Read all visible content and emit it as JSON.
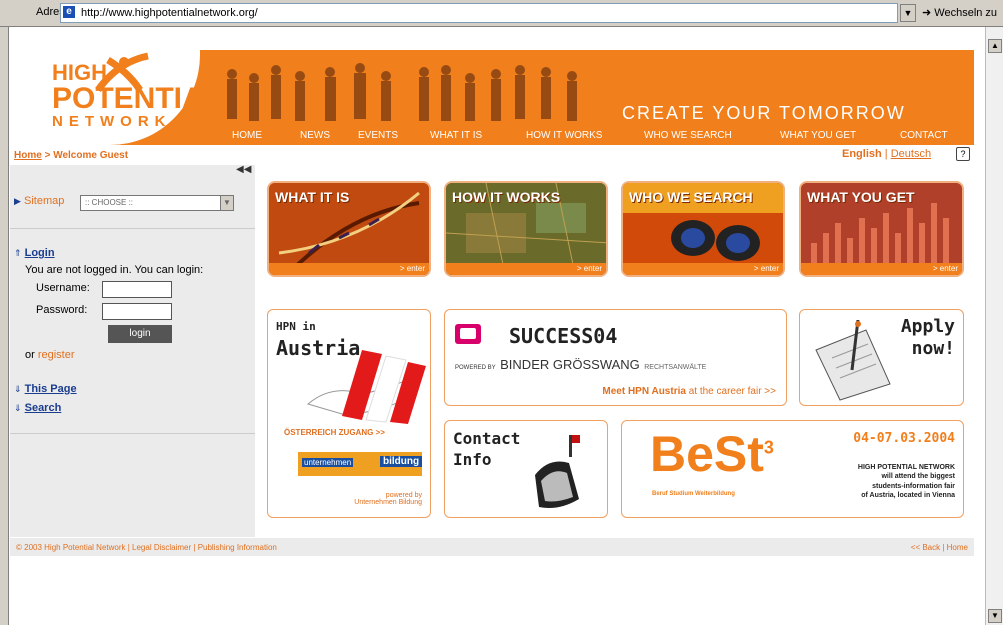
{
  "browser": {
    "address_label": "Adresse",
    "url": "http://www.highpotentialnetwork.org/",
    "go_label": "Wechseln zu"
  },
  "header": {
    "logo": {
      "line1": "HIGH",
      "line2": "POTENTIAL",
      "line3": "NETWORK"
    },
    "tagline": "CREATE YOUR TOMORROW",
    "nav": [
      "HOME",
      "NEWS",
      "EVENTS",
      "WHAT IT IS",
      "HOW IT WORKS",
      "WHO WE SEARCH",
      "WHAT YOU GET",
      "CONTACT"
    ]
  },
  "breadcrumb": {
    "home": "Home",
    "rest": " > Welcome Guest"
  },
  "language": {
    "english": "English",
    "sep": " | ",
    "deutsch": "Deutsch"
  },
  "sidebar": {
    "sitemap_label": "Sitemap",
    "sitemap_select": ":: CHOOSE ::",
    "login_title": "Login",
    "login_text": "You are not logged in. You can login:",
    "username_label": "Username:",
    "password_label": "Password:",
    "login_button": "login",
    "register_prefix": "or ",
    "register_link": "register",
    "this_page": "This Page",
    "search": "Search"
  },
  "tiles": [
    {
      "title": "WHAT IT IS",
      "enter": "> enter"
    },
    {
      "title": "HOW IT WORKS",
      "enter": "> enter"
    },
    {
      "title": "WHO WE SEARCH",
      "enter": "> enter"
    },
    {
      "title": "WHAT YOU GET",
      "enter": "> enter"
    }
  ],
  "austria": {
    "line1": "HPN in",
    "line2": "Austria",
    "zugang": "ÖSTERREICH ZUGANG >>",
    "partner_a": "unternehmen",
    "partner_b": "bildung",
    "powered1": "powered by",
    "powered2": "Unternehmen Bildung"
  },
  "success": {
    "title": "SUCCESS04",
    "powered": "POWERED BY",
    "sponsor": "BINDER GRÖSSWANG",
    "sponsor_suffix": "RECHTSANWÄLTE",
    "meet": "Meet HPN Austria",
    "fair": " at the career fair >>"
  },
  "apply": {
    "line1": "Apply",
    "line2": "now!"
  },
  "contact": {
    "line1": "Contact",
    "line2": "Info"
  },
  "best": {
    "logo": "BeSt",
    "sup": "3",
    "sub": "Beruf Studium Weiterbildung",
    "date": "04-07.03.2004",
    "desc1": "HIGH POTENTIAL NETWORK",
    "desc2": "will attend the biggest",
    "desc3": "students-information fair",
    "desc4": "of Austria, located in Vienna"
  },
  "footer": {
    "left": "© 2003 High Potential Network | Legal Disclaimer | Publishing Information",
    "right": "<< Back | Home"
  }
}
